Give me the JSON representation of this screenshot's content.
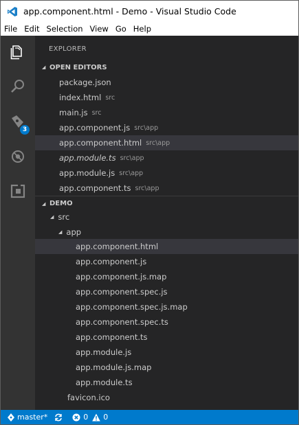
{
  "window": {
    "title": "app.component.html - Demo - Visual Studio Code",
    "logo_icon": "vscode-logo-icon"
  },
  "menu": [
    "File",
    "Edit",
    "Selection",
    "View",
    "Go",
    "Help"
  ],
  "activity_bar": {
    "items": [
      "explorer-icon",
      "search-icon",
      "source-control-icon",
      "debug-icon",
      "extensions-icon"
    ],
    "source_control_badge": "3"
  },
  "sidebar": {
    "title": "EXPLORER",
    "open_editors": {
      "header": "OPEN EDITORS",
      "items": [
        {
          "name": "package.json",
          "desc": ""
        },
        {
          "name": "index.html",
          "desc": "src"
        },
        {
          "name": "main.js",
          "desc": "src"
        },
        {
          "name": "app.component.js",
          "desc": "src\\app"
        },
        {
          "name": "app.component.html",
          "desc": "src\\app",
          "selected": true
        },
        {
          "name": "app.module.ts",
          "desc": "src\\app",
          "italic": true
        },
        {
          "name": "app.module.js",
          "desc": "src\\app"
        },
        {
          "name": "app.component.ts",
          "desc": "src\\app"
        }
      ]
    },
    "workspace": {
      "header": "DEMO",
      "src_label": "src",
      "app_label": "app",
      "app_files": [
        "app.component.html",
        "app.component.js",
        "app.component.js.map",
        "app.component.spec.js",
        "app.component.spec.js.map",
        "app.component.spec.ts",
        "app.component.ts",
        "app.module.js",
        "app.module.js.map",
        "app.module.ts"
      ],
      "src_files": [
        "favicon.ico"
      ]
    }
  },
  "statusbar": {
    "branch": "master*",
    "errors": "0",
    "warnings": "0",
    "colors": {
      "background": "#007acc"
    }
  },
  "colors": {
    "activity_bar": "#333333",
    "sidebar": "#252526",
    "selection": "#37373d",
    "accent": "#007acc"
  }
}
